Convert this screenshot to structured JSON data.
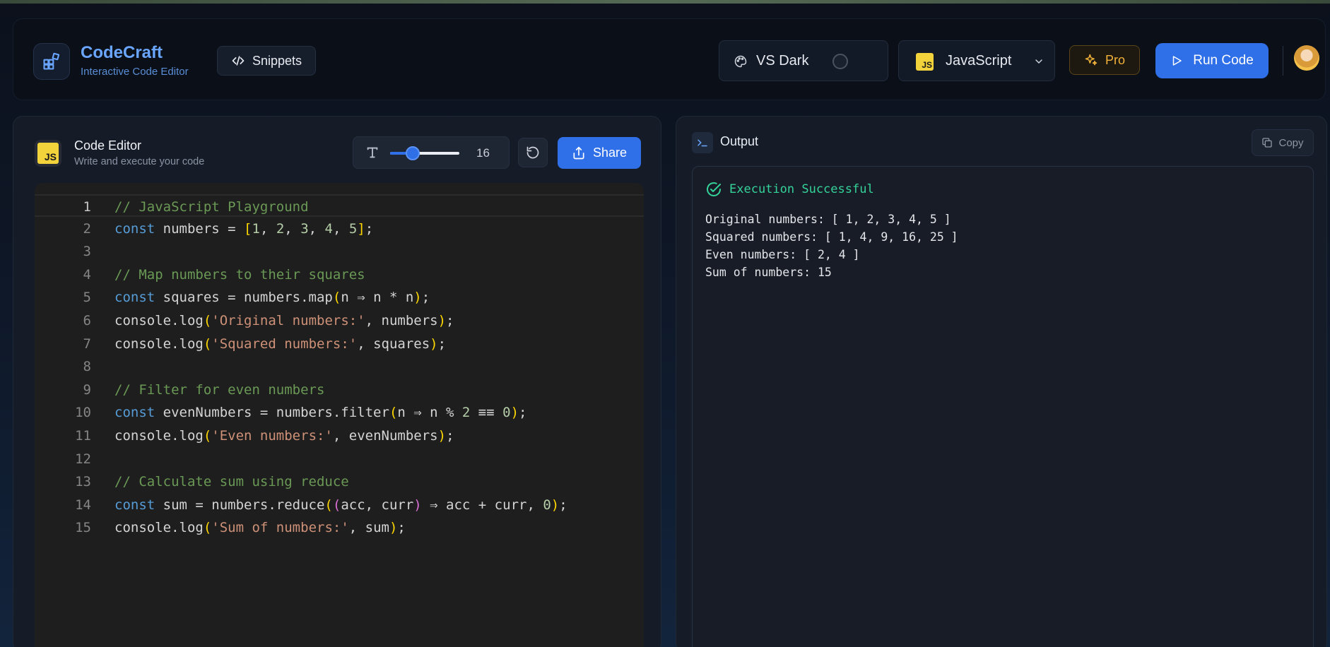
{
  "header": {
    "brand_title": "CodeCraft",
    "brand_subtitle": "Interactive Code Editor",
    "snippets_label": "Snippets",
    "theme_label": "VS Dark",
    "language_label": "JavaScript",
    "language_badge": "JS",
    "pro_label": "Pro",
    "run_label": "Run Code"
  },
  "editor": {
    "title": "Code Editor",
    "subtitle": "Write and execute your code",
    "badge": "JS",
    "font_size": "16",
    "font_slider_fraction": 0.35,
    "share_label": "Share",
    "lines": [
      {
        "n": "1",
        "tokens": [
          [
            "com",
            "// JavaScript Playground"
          ]
        ]
      },
      {
        "n": "2",
        "tokens": [
          [
            "kw",
            "const"
          ],
          [
            "id",
            " numbers = "
          ],
          [
            "br1",
            "["
          ],
          [
            "num",
            "1"
          ],
          [
            "id",
            ", "
          ],
          [
            "num",
            "2"
          ],
          [
            "id",
            ", "
          ],
          [
            "num",
            "3"
          ],
          [
            "id",
            ", "
          ],
          [
            "num",
            "4"
          ],
          [
            "id",
            ", "
          ],
          [
            "num",
            "5"
          ],
          [
            "br1",
            "]"
          ],
          [
            "id",
            ";"
          ]
        ]
      },
      {
        "n": "3",
        "tokens": []
      },
      {
        "n": "4",
        "tokens": [
          [
            "com",
            "// Map numbers to their squares"
          ]
        ]
      },
      {
        "n": "5",
        "tokens": [
          [
            "kw",
            "const"
          ],
          [
            "id",
            " squares = numbers.map"
          ],
          [
            "br1",
            "("
          ],
          [
            "id",
            "n ⇒ n * n"
          ],
          [
            "br1",
            ")"
          ],
          [
            "id",
            ";"
          ]
        ]
      },
      {
        "n": "6",
        "tokens": [
          [
            "id",
            "console.log"
          ],
          [
            "br1",
            "("
          ],
          [
            "str",
            "'Original numbers:'"
          ],
          [
            "id",
            ", numbers"
          ],
          [
            "br1",
            ")"
          ],
          [
            "id",
            ";"
          ]
        ]
      },
      {
        "n": "7",
        "tokens": [
          [
            "id",
            "console.log"
          ],
          [
            "br1",
            "("
          ],
          [
            "str",
            "'Squared numbers:'"
          ],
          [
            "id",
            ", squares"
          ],
          [
            "br1",
            ")"
          ],
          [
            "id",
            ";"
          ]
        ]
      },
      {
        "n": "8",
        "tokens": []
      },
      {
        "n": "9",
        "tokens": [
          [
            "com",
            "// Filter for even numbers"
          ]
        ]
      },
      {
        "n": "10",
        "tokens": [
          [
            "kw",
            "const"
          ],
          [
            "id",
            " evenNumbers = numbers.filter"
          ],
          [
            "br1",
            "("
          ],
          [
            "id",
            "n ⇒ n % "
          ],
          [
            "num",
            "2"
          ],
          [
            "id",
            " ≡≡ "
          ],
          [
            "num",
            "0"
          ],
          [
            "br1",
            ")"
          ],
          [
            "id",
            ";"
          ]
        ]
      },
      {
        "n": "11",
        "tokens": [
          [
            "id",
            "console.log"
          ],
          [
            "br1",
            "("
          ],
          [
            "str",
            "'Even numbers:'"
          ],
          [
            "id",
            ", evenNumbers"
          ],
          [
            "br1",
            ")"
          ],
          [
            "id",
            ";"
          ]
        ]
      },
      {
        "n": "12",
        "tokens": []
      },
      {
        "n": "13",
        "tokens": [
          [
            "com",
            "// Calculate sum using reduce"
          ]
        ]
      },
      {
        "n": "14",
        "tokens": [
          [
            "kw",
            "const"
          ],
          [
            "id",
            " sum = numbers.reduce"
          ],
          [
            "br1",
            "("
          ],
          [
            "br2",
            "("
          ],
          [
            "id",
            "acc, curr"
          ],
          [
            "br2",
            ")"
          ],
          [
            "id",
            " ⇒ acc + curr, "
          ],
          [
            "num",
            "0"
          ],
          [
            "br1",
            ")"
          ],
          [
            "id",
            ";"
          ]
        ]
      },
      {
        "n": "15",
        "tokens": [
          [
            "id",
            "console.log"
          ],
          [
            "br1",
            "("
          ],
          [
            "str",
            "'Sum of numbers:'"
          ],
          [
            "id",
            ", sum"
          ],
          [
            "br1",
            ")"
          ],
          [
            "id",
            ";"
          ]
        ]
      }
    ]
  },
  "output": {
    "title": "Output",
    "copy_label": "Copy",
    "status": "Execution Successful",
    "lines": [
      "Original numbers: [ 1, 2, 3, 4, 5 ]",
      "Squared numbers: [ 1, 4, 9, 16, 25 ]",
      "Even numbers: [ 2, 4 ]",
      "Sum of numbers: 15"
    ]
  },
  "colors": {
    "accent": "#2f6fe8",
    "success": "#34d399",
    "pro": "#f1b23a",
    "js_badge": "#f2d33c"
  },
  "icons": {
    "logo": "grid-blocks-icon",
    "snippets": "code-icon",
    "theme": "palette-icon",
    "language_chevron": "chevron-down-icon",
    "pro": "sparkles-icon",
    "run": "play-icon",
    "font": "text-size-icon",
    "reset": "reset-icon",
    "share": "share-icon",
    "terminal": "terminal-icon",
    "copy": "copy-icon",
    "success": "check-circle-icon"
  }
}
